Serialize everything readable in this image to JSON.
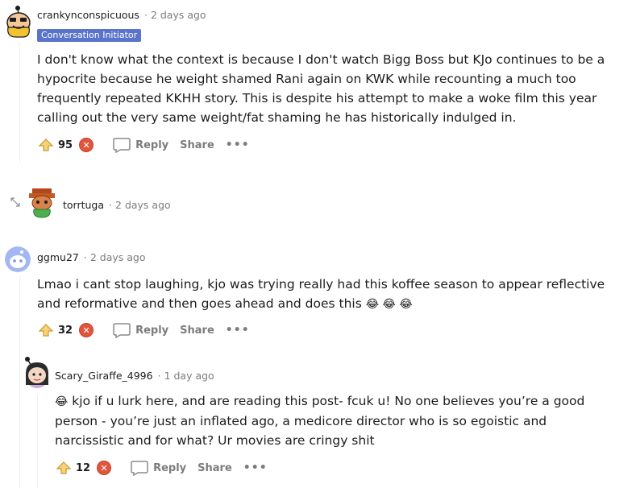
{
  "comments": [
    {
      "username": "crankynconspicuous",
      "time": "2 days ago",
      "flair": "Conversation Initiator",
      "body": "I don't know what the context is because I don't watch Bigg Boss but KJo continues to be a hypocrite because he weight shamed Rani again on KWK while recounting a much too frequently repeated KKHH story. This is despite his attempt to make a woke film this year calling out the very same weight/fat shaming he has historically indulged in.",
      "score": "95"
    },
    {
      "username": "torrtuga",
      "time": "2 days ago"
    },
    {
      "username": "ggmu27",
      "time": "2 days ago",
      "body": "Lmao i cant stop laughing, kjo was trying really had this koffee season to appear reflective and reformative and then goes ahead and does this",
      "emoji": "😂 😂 😂",
      "score": "32"
    },
    {
      "username": "Scary_Giraffe_4996",
      "time": "1 day ago",
      "emoji": "😂",
      "body": "kjo if u lurk here, and are reading this post- fcuk u! No one believes you’re a good person - you’re just an inflated ago, a medicore director who is so egoistic and narcissistic and for what? Ur movies are cringy shit",
      "score": "12"
    }
  ],
  "labels": {
    "reply": "Reply",
    "share": "Share",
    "more": "•••",
    "separator": "·"
  },
  "icons": {
    "upvote": "upvote-arrow-icon",
    "downvote": "downvote-x-icon",
    "reply": "comment-bubble-icon",
    "expand": "expand-arrows-icon"
  },
  "colors": {
    "flair_bg": "#5a74cc",
    "downvote": "#e0553d",
    "meta_text": "#7c7c7c",
    "thread_line": "#edeff1"
  }
}
